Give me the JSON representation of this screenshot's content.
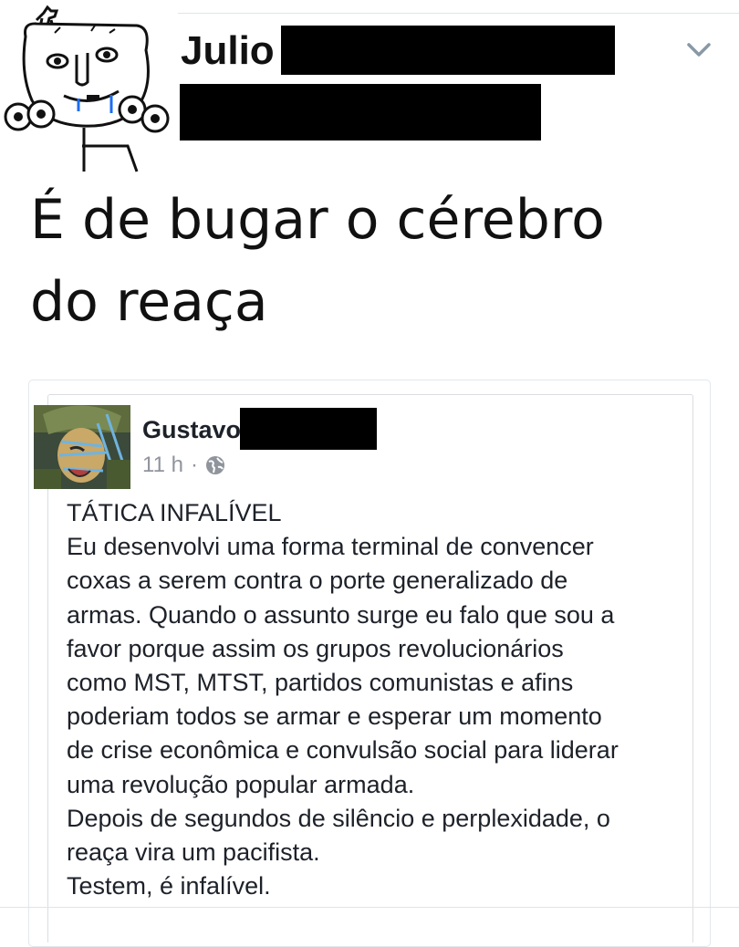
{
  "tweet": {
    "author_name": "Julio",
    "text_lines": [
      "É de bugar o cérebro",
      "do reaça"
    ]
  },
  "embedded_post": {
    "author_name": "Gustavo",
    "time": "11 h",
    "separator": "·",
    "body_lines": [
      "TÁTICA INFALÍVEL",
      "Eu desenvolvi uma forma terminal de convencer",
      "coxas a serem contra o porte generalizado de",
      "armas. Quando o assunto surge eu falo que sou a",
      "favor porque assim os grupos revolucionários",
      "como MST, MTST, partidos comunistas e afins",
      "poderiam todos se armar e esperar um momento",
      "de crise econômica e convulsão social para liderar",
      "uma revolução popular armada.",
      "Depois de segundos de silêncio e perplexidade, o",
      "reaça vira um pacifista.",
      "Testem, é infalível."
    ]
  },
  "icons": {
    "menu": "chevron-down-icon",
    "privacy": "globe-icon"
  }
}
